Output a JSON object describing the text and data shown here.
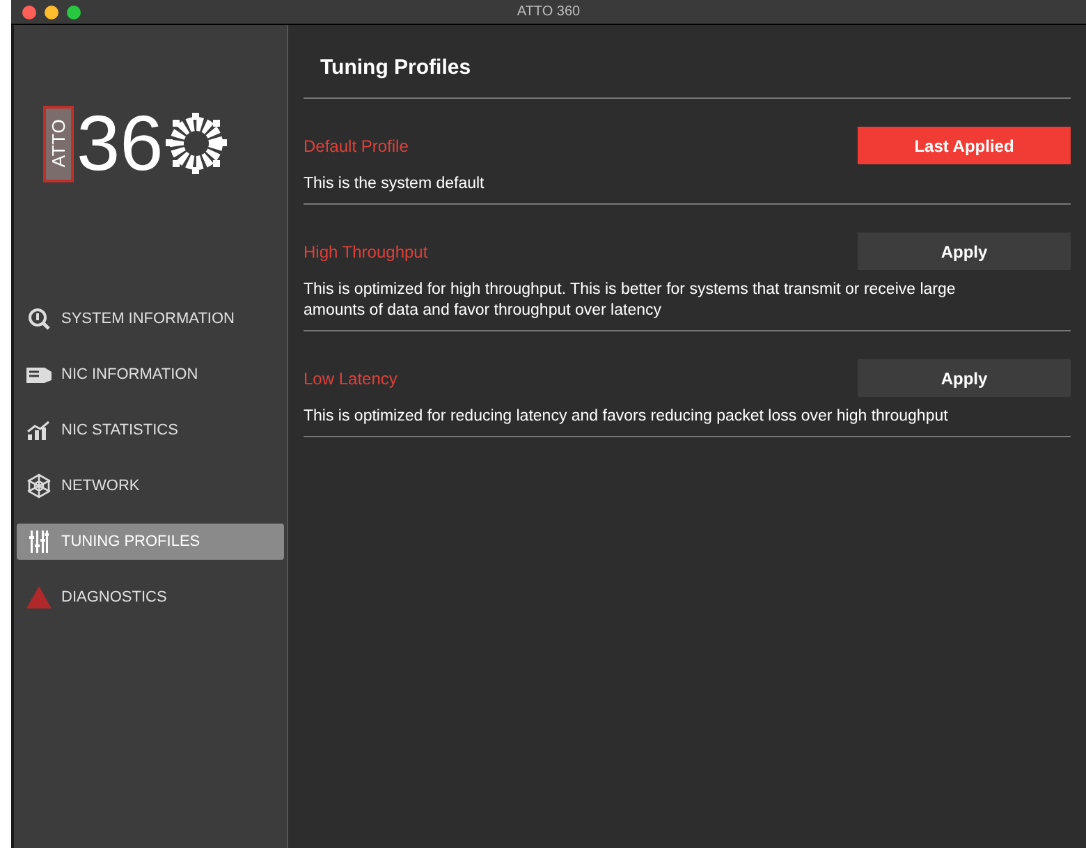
{
  "window": {
    "title": "ATTO 360"
  },
  "logo": {
    "badge": "ATTO",
    "number": "36"
  },
  "sidebar": {
    "items": [
      {
        "label": "SYSTEM INFORMATION",
        "kind": "info",
        "selected": false
      },
      {
        "label": "NIC INFORMATION",
        "kind": "nic",
        "selected": false
      },
      {
        "label": "NIC STATISTICS",
        "kind": "stats",
        "selected": false
      },
      {
        "label": "NETWORK",
        "kind": "network",
        "selected": false
      },
      {
        "label": "TUNING PROFILES",
        "kind": "tuning",
        "selected": true
      },
      {
        "label": "DIAGNOSTICS",
        "kind": "diagnostics",
        "selected": false
      }
    ]
  },
  "page": {
    "title": "Tuning Profiles"
  },
  "profiles": [
    {
      "name": "Default Profile",
      "description": "This is the system default",
      "button": "Last Applied",
      "last_applied": true
    },
    {
      "name": "High Throughput",
      "description": "This is optimized for high throughput. This is better for systems that transmit or receive large amounts of data and favor throughput over latency",
      "button": "Apply",
      "last_applied": false
    },
    {
      "name": "Low Latency",
      "description": "This is optimized for reducing latency and favors reducing packet loss over high throughput",
      "button": "Apply",
      "last_applied": false
    }
  ]
}
